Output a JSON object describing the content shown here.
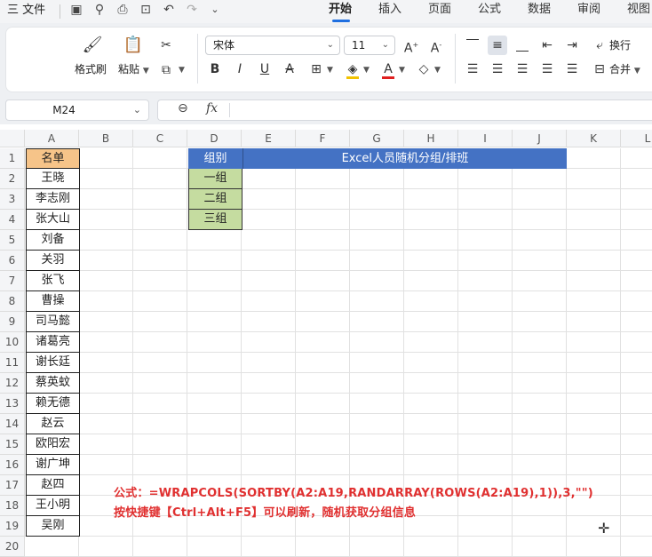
{
  "menubar": {
    "menu_label": "三 文件",
    "tabs": [
      "开始",
      "插入",
      "页面",
      "公式",
      "数据",
      "审阅",
      "视图"
    ],
    "active_tab": "开始"
  },
  "ribbon": {
    "format_painter": "格式刷",
    "paste": "粘贴",
    "font_name": "宋体",
    "font_size": "11",
    "wrap": "换行",
    "merge": "合并"
  },
  "formula_bar": {
    "cell_ref": "M24",
    "fx": "fx",
    "formula": ""
  },
  "sheet": {
    "columns": [
      "A",
      "B",
      "C",
      "D",
      "E",
      "F",
      "G",
      "H",
      "I",
      "J",
      "K",
      "L"
    ],
    "rows": [
      "1",
      "2",
      "3",
      "4",
      "5",
      "6",
      "7",
      "8",
      "9",
      "10",
      "11",
      "12",
      "13",
      "14",
      "15",
      "16",
      "17",
      "18",
      "19",
      "20"
    ],
    "a1_header": "名单",
    "names": [
      "王晓",
      "李志刚",
      "张大山",
      "刘备",
      "关羽",
      "张飞",
      "曹操",
      "司马懿",
      "诸葛亮",
      "谢长廷",
      "蔡英蚊",
      "赖无德",
      "赵云",
      "欧阳宏",
      "谢广坤",
      "赵四",
      "王小明",
      "吴刚"
    ],
    "d1_header": "组别",
    "groups": [
      "一组",
      "二组",
      "三组"
    ],
    "title": "Excel人员随机分组/排班",
    "note_line1": "公式：=WRAPCOLS(SORTBY(A2:A19,RANDARRAY(ROWS(A2:A19),1)),3,\"\")",
    "note_line2": "按快捷键【Ctrl+Alt+F5】可以刷新，随机获取分组信息"
  },
  "colors": {
    "a1_fill": "#f6c489",
    "d1_fill": "#4472c4",
    "group_fill": "#c5dca0",
    "title_fill": "#4472c4",
    "note_color": "#e03030",
    "active_tab_underline": "#1f6fe0"
  }
}
